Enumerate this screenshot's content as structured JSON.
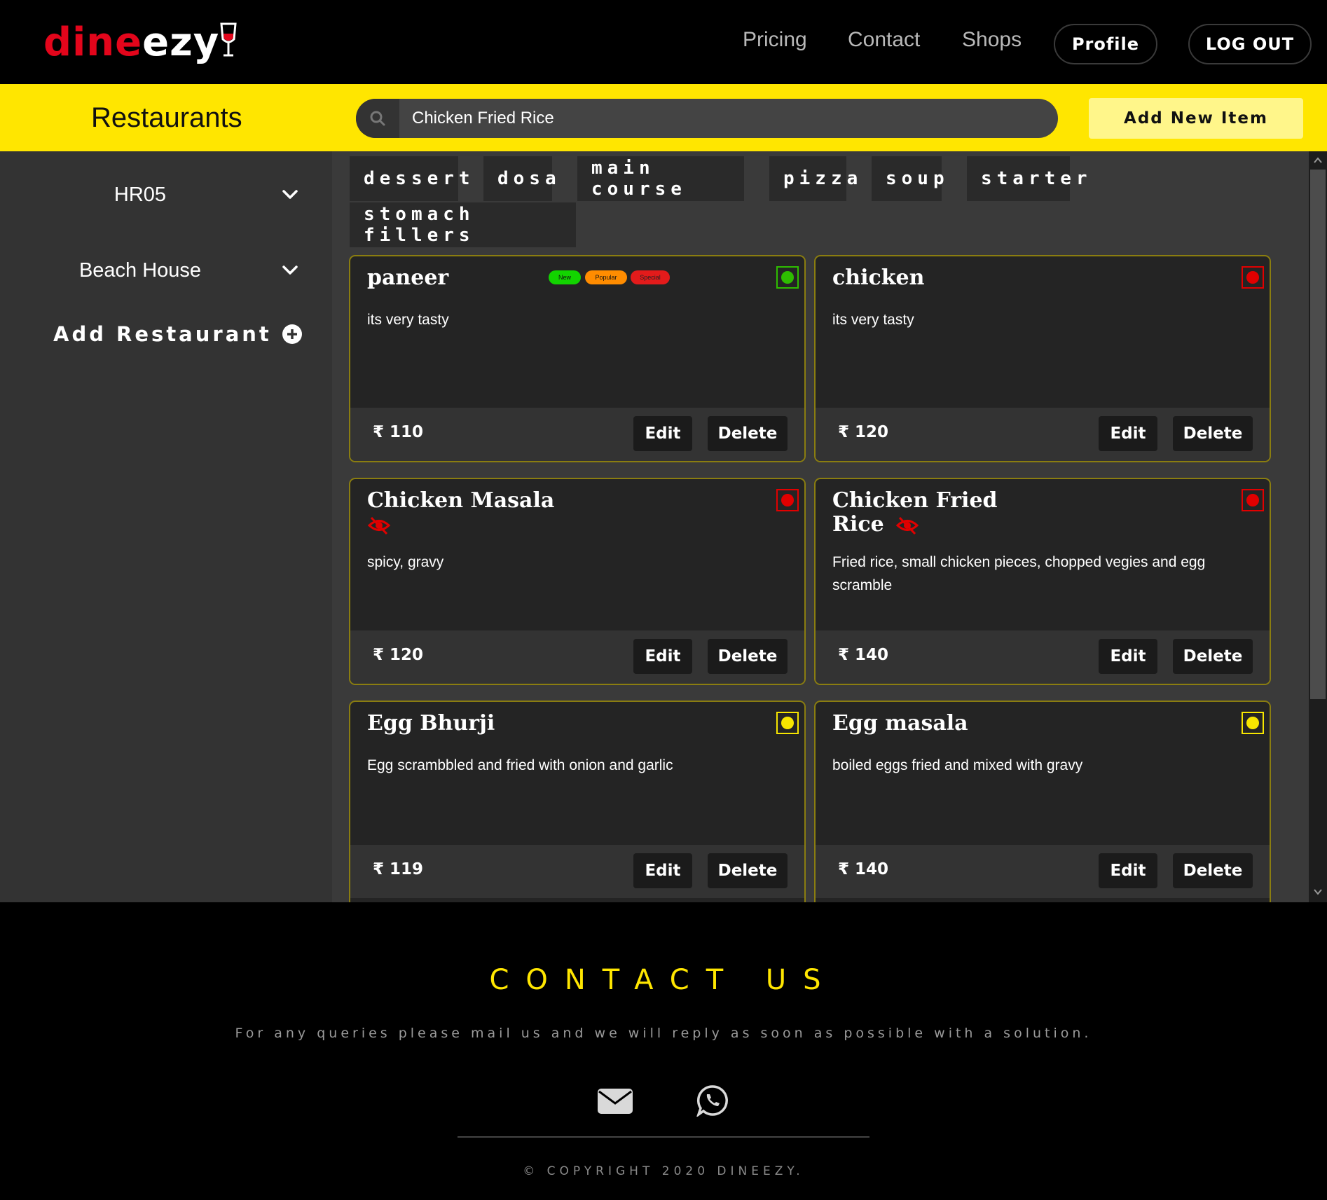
{
  "brand": {
    "logo_red": "dine",
    "logo_white": "ezy"
  },
  "nav": {
    "links": [
      "Pricing",
      "Contact",
      "Shops"
    ],
    "profile_label": "Profile",
    "logout_label": "LOG OUT"
  },
  "toolbar": {
    "title": "Restaurants",
    "search_value": "Chicken Fried Rice",
    "add_item_label": "Add New Item"
  },
  "sidebar": {
    "restaurants": [
      {
        "label": "HR05"
      },
      {
        "label": "Beach House"
      }
    ],
    "add_restaurant_label": "Add Restaurant"
  },
  "categories": [
    "dessert",
    "dosa",
    "main course",
    "pizza",
    "soup",
    "starter",
    "stomach fillers"
  ],
  "items": [
    {
      "name": "paneer",
      "description": "its very tasty",
      "price": "₹ 110",
      "veg_type": "veg",
      "badges": [
        "New",
        "Popular",
        "Special"
      ],
      "hidden": false
    },
    {
      "name": "chicken",
      "description": "its very tasty",
      "price": "₹ 120",
      "veg_type": "nonveg",
      "badges": [],
      "hidden": false
    },
    {
      "name": "Chicken Masala",
      "description": "spicy, gravy",
      "price": "₹ 120",
      "veg_type": "nonveg",
      "badges": [],
      "hidden": true
    },
    {
      "name": "Chicken Fried Rice",
      "description": "Fried rice, small chicken pieces, chopped vegies and egg scramble",
      "price": "₹ 140",
      "veg_type": "nonveg",
      "badges": [],
      "hidden": true
    },
    {
      "name": "Egg Bhurji",
      "description": "Egg scrambbled and fried with onion and garlic",
      "price": "₹ 119",
      "veg_type": "egg",
      "badges": [],
      "hidden": false
    },
    {
      "name": "Egg masala",
      "description": "boiled eggs fried and mixed with gravy",
      "price": "₹ 140",
      "veg_type": "egg",
      "badges": [],
      "hidden": false
    }
  ],
  "card_actions": {
    "edit_label": "Edit",
    "delete_label": "Delete"
  },
  "footer": {
    "title": "CONTACT US",
    "subtitle": "For any queries please mail us and we will reply as soon as possible with a solution.",
    "icons": [
      "envelope-icon",
      "whatsapp-icon"
    ],
    "copyright": "© COPYRIGHT 2020 DINEEZY."
  },
  "colors": {
    "accent": "#ffe600",
    "brand_red": "#e3051b",
    "veg": "#2ebd00",
    "nonveg": "#e10000",
    "egg": "#f7e600",
    "badge_new": "#12d400",
    "badge_popular": "#ff8c00",
    "badge_special": "#e31b1b"
  }
}
